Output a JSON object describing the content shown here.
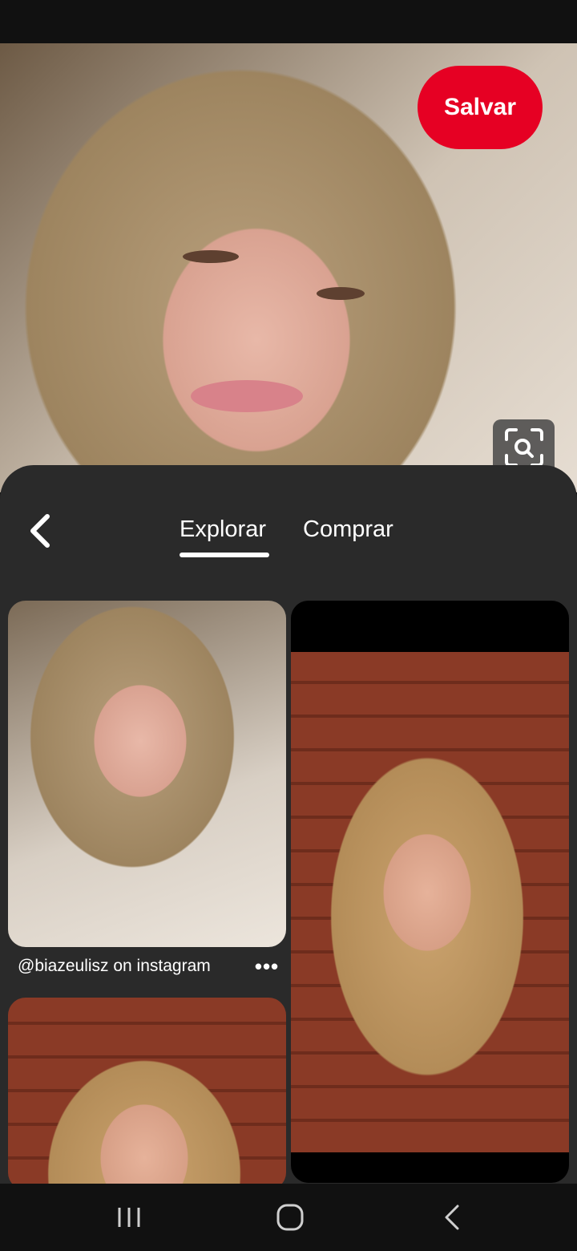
{
  "header": {
    "save_label": "Salvar"
  },
  "sheet": {
    "tabs": [
      {
        "label": "Explorar",
        "active": true
      },
      {
        "label": "Comprar",
        "active": false
      }
    ]
  },
  "pins": [
    {
      "caption": "@biazeulisz on instagram",
      "more_label": "•••"
    },
    {
      "caption": ""
    },
    {
      "caption": ""
    }
  ],
  "icons": {
    "back": "chevron-left-icon",
    "lens": "visual-search-icon",
    "recents": "recent-apps-icon",
    "home": "home-icon",
    "nav_back": "back-icon"
  },
  "colors": {
    "accent": "#e60023",
    "sheet_bg": "#2a2a2a",
    "bars_bg": "#111111"
  }
}
